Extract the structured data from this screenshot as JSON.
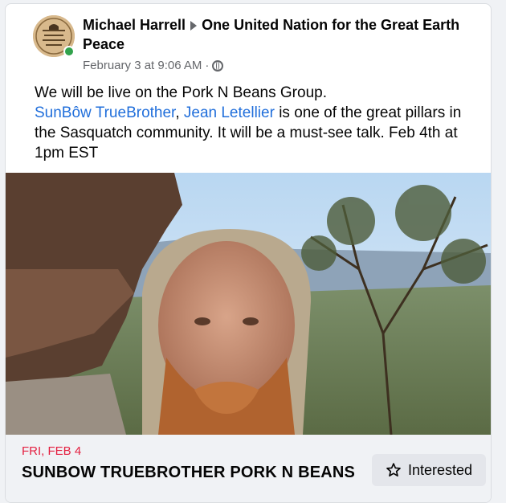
{
  "post": {
    "author": "Michael Harrell",
    "group": "One United Nation for the Great Earth Peace",
    "timestamp": "February 3 at 9:06 AM",
    "separator": "·",
    "text_line1": "We will be live on the Pork N Beans Group.",
    "mention1": "SunBôw TrueBrother",
    "comma": ",",
    "mention2": "Jean Letellier",
    "text_rest": " is one of the great pillars in the Sasquatch community. It will be a must-see talk.  Feb 4th at 1pm EST"
  },
  "event": {
    "date": "FRI, FEB 4",
    "title": "SUNBOW TRUEBROTHER PORK N BEANS",
    "interested_label": "Interested"
  },
  "icons": {
    "privacy": "globe-icon",
    "interested": "star-icon",
    "author_to_group": "arrow-right-icon"
  },
  "colors": {
    "mention": "#216fdb",
    "event_date": "#e41e3f",
    "presence": "#31a24c"
  }
}
